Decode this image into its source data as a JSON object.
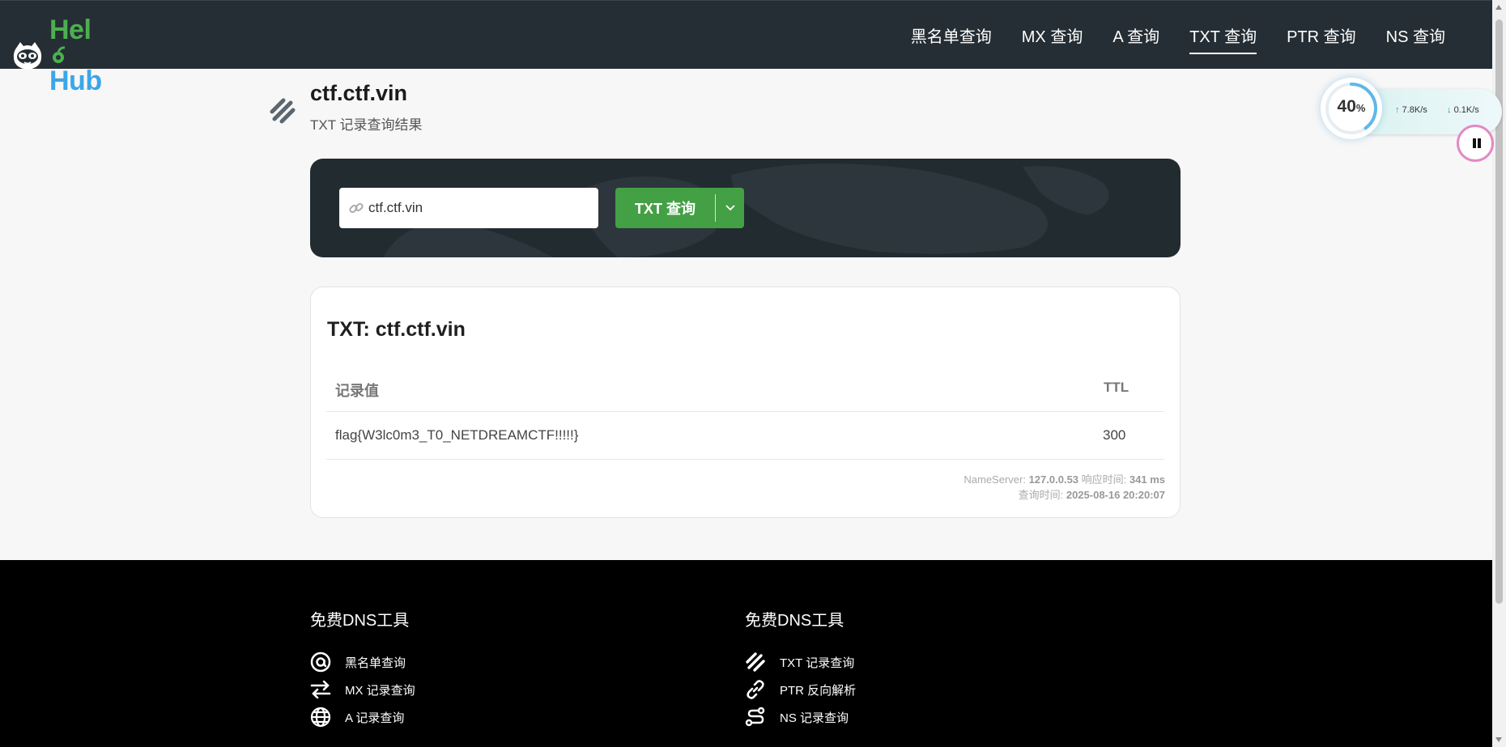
{
  "header": {
    "logo": {
      "part1": "Hel",
      "part2": "Hub"
    },
    "nav": [
      "黑名单查询",
      "MX 查询",
      "A 查询",
      "TXT 查询",
      "PTR 查询",
      "NS 查询"
    ],
    "active_nav": "TXT 查询"
  },
  "page": {
    "title": "ctf.ctf.vin",
    "subtitle": "TXT 记录查询结果"
  },
  "search": {
    "input_value": "ctf.ctf.vin",
    "button_label": "TXT 查询"
  },
  "result": {
    "title": "TXT: ctf.ctf.vin",
    "columns": [
      "记录值",
      "TTL"
    ],
    "rows": [
      {
        "value": "flag{W3lc0m3_T0_NETDREAMCTF!!!!!}",
        "ttl": "300"
      }
    ],
    "meta": {
      "nameserver_label": "NameServer:",
      "nameserver": "127.0.0.53",
      "response_label": "响应时间:",
      "response": "341 ms",
      "query_time_label": "查询时间:",
      "query_time": "2025-08-16 20:20:07"
    }
  },
  "footer": {
    "col1_title": "免费DNS工具",
    "col1_links": [
      "黑名单查询",
      "MX 记录查询",
      "A 记录查询"
    ],
    "col2_title": "免费DNS工具",
    "col2_links": [
      "TXT 记录查询",
      "PTR 反向解析",
      "NS 记录查询"
    ]
  },
  "speed_widget": {
    "percent": "40",
    "percent_unit": "%",
    "upload": "7.8K/s",
    "download": "0.1K/s",
    "progress_fraction": 0.4
  },
  "colors": {
    "header_bg": "#252e34",
    "accent_green": "#43a044",
    "logo_blue": "#3ba6e8",
    "footer_bg": "#000000"
  }
}
